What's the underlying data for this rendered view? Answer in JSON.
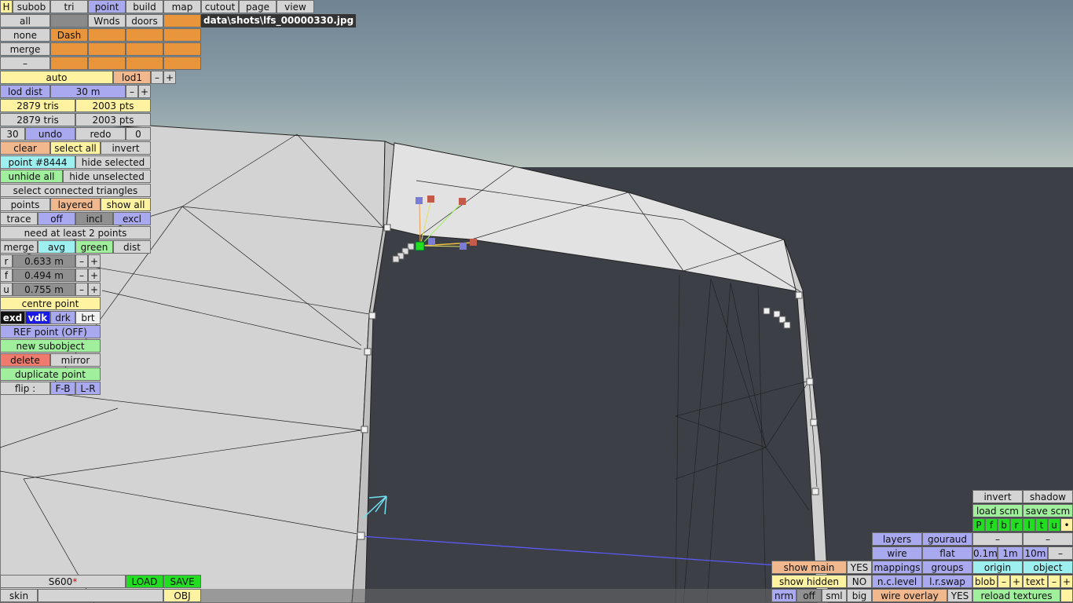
{
  "top_tabs": [
    "H",
    "subob",
    "tri",
    "point",
    "build",
    "map",
    "cutout",
    "page",
    "view"
  ],
  "row2": {
    "all": "all",
    "wnds": "Wnds",
    "doors": "doors"
  },
  "row3": {
    "none": "none",
    "dash": "Dash"
  },
  "row4": {
    "merge": "merge"
  },
  "row5": {
    "dash": "–"
  },
  "file_label": "data\\shots\\lfs_00000330.jpg",
  "lod": {
    "auto": "auto",
    "lod1": "lod1",
    "minus": "–",
    "plus": "+",
    "dist_label": "lod dist",
    "dist_value": "30 m"
  },
  "stats": {
    "tris1": "2879 tris",
    "pts1": "2003 pts",
    "tris2": "2879 tris",
    "pts2": "2003 pts"
  },
  "undo": {
    "count": "30",
    "undo": "undo",
    "redo": "redo",
    "redo_count": "0"
  },
  "select": {
    "clear": "clear",
    "select_all": "select all",
    "invert": "invert"
  },
  "point_info": {
    "point": "point #8444",
    "hide_selected": "hide selected",
    "unhide_all": "unhide all",
    "hide_unselected": "hide unselected",
    "select_connected": "select connected triangles"
  },
  "points_row": {
    "points": "points",
    "layered": "layered",
    "show_all": "show all"
  },
  "trace_row": {
    "trace": "trace",
    "off": "off",
    "incl": "incl",
    "excl": "excl"
  },
  "need": "need at least 2 points",
  "merge_row": {
    "merge": "merge",
    "avg": "avg",
    "green": "green",
    "dist": "dist"
  },
  "coords": [
    {
      "axis": "r",
      "value": "0.633 m"
    },
    {
      "axis": "f",
      "value": "0.494 m"
    },
    {
      "axis": "u",
      "value": "0.755 m"
    }
  ],
  "centre_point": "centre point",
  "shade": {
    "exd": "exd",
    "vdk": "vdk",
    "drk": "drk",
    "brt": "brt"
  },
  "ref_point": "REF point (OFF)",
  "new_subobject": "new subobject",
  "delete": "delete",
  "mirror": "mirror",
  "duplicate_point": "duplicate point",
  "flip": {
    "label": "flip :",
    "fb": "F-B",
    "lr": "L-R"
  },
  "bottom_left": {
    "s600": "S600",
    "star": "*",
    "load": "LOAD",
    "save": "SAVE",
    "skin": "skin",
    "obj": "OBJ"
  },
  "bottom_right": {
    "invert": "invert",
    "shadow": "shadow",
    "load_scm": "load scm",
    "save_scm": "save scm",
    "letters": [
      "P",
      "f",
      "b",
      "r",
      "l",
      "t",
      "u",
      "•"
    ],
    "layers": "layers",
    "gouraud": "gouraud",
    "wire": "wire",
    "flat": "flat",
    "steps": [
      "0.1m",
      "1m",
      "10m"
    ],
    "mappings": "mappings",
    "groups": "groups",
    "origin": "origin",
    "object": "object",
    "nclevel": "n.c.level",
    "lrswap": "l.r.swap",
    "blob": "blob",
    "text": "text",
    "wire_overlay": "wire overlay",
    "yes": "YES",
    "reload_textures": "reload textures",
    "show_main": "show main",
    "show_main_val": "YES",
    "show_hidden": "show hidden",
    "show_hidden_val": "NO",
    "nrm": "nrm",
    "off": "off",
    "sml": "sml",
    "big": "big",
    "minus": "–",
    "plus": "+"
  }
}
